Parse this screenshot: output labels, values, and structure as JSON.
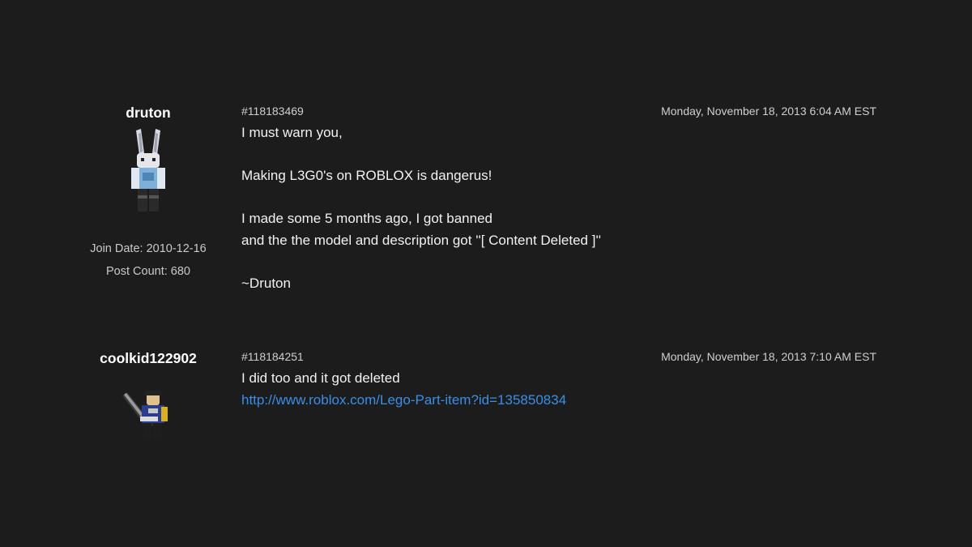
{
  "posts": [
    {
      "author": {
        "username": "druton",
        "avatar_icon": "bunny-ears-avatar-icon",
        "join_date": "Join Date: 2010-12-16",
        "post_count": "Post Count: 680"
      },
      "post_id": "#118183469",
      "timestamp": "Monday, November 18, 2013 6:04 AM EST",
      "lines": [
        "I must warn you,",
        "",
        "Making L3G0's on ROBLOX is dangerus!",
        "",
        "I made some 5 months ago, I got banned",
        "and the the model and description got ''[ Content Deleted ]''",
        "",
        "~Druton"
      ]
    },
    {
      "author": {
        "username": "coolkid122902",
        "avatar_icon": "robloxian-with-weapon-avatar-icon"
      },
      "post_id": "#118184251",
      "timestamp": "Monday, November 18, 2013 7:10 AM EST",
      "lines": [
        "I did too and it got deleted"
      ],
      "link": "http://www.roblox.com/Lego-Part-item?id=135850834"
    }
  ],
  "colors": {
    "background": "#1c1c1c",
    "link": "#3a8ee6",
    "text": "#f2f2f2"
  }
}
